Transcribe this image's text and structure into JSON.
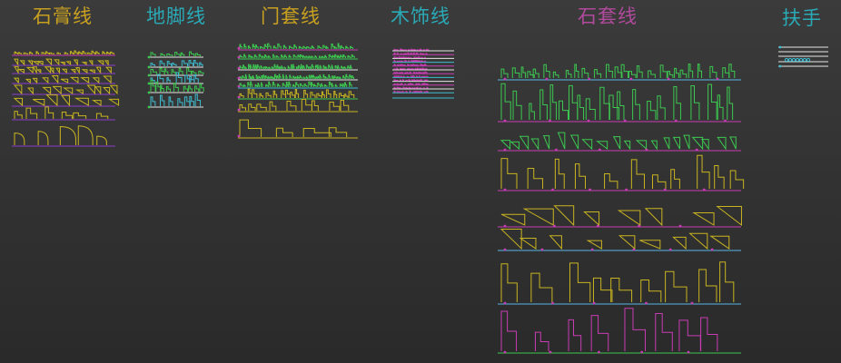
{
  "groups": [
    {
      "id": "plaster",
      "title": "石膏线",
      "title_color": "#c8a020"
    },
    {
      "id": "skirting",
      "title": "地脚线",
      "title_color": "#2aa9b6"
    },
    {
      "id": "door_casing",
      "title": "门套线",
      "title_color": "#c8a020"
    },
    {
      "id": "wood_trim",
      "title": "木饰线",
      "title_color": "#2aa9b6"
    },
    {
      "id": "stone_casing",
      "title": "石套线",
      "title_color": "#b04a9c"
    },
    {
      "id": "handrail",
      "title": "扶手",
      "title_color": "#2aa9b6"
    }
  ],
  "colors": {
    "yellow": "#c8b420",
    "green": "#3cc850",
    "cyan": "#3cbcd0",
    "magenta": "#c83cb4",
    "purple": "#8a3ccc",
    "white": "#e6e6e6",
    "red": "#d23c5a",
    "blue": "#5ab4e6"
  }
}
